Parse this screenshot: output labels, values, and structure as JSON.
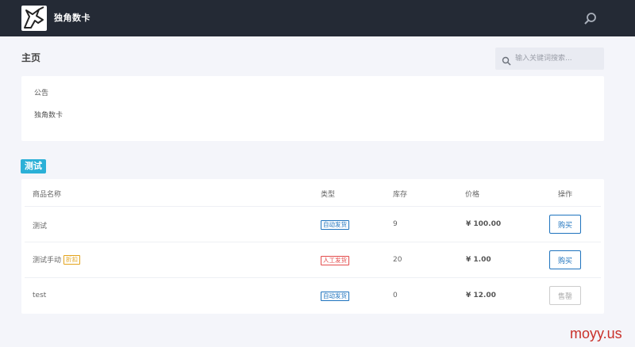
{
  "header": {
    "brand": "独角数卡",
    "logo_icon": "unicorn-logo",
    "search_icon": "search-icon"
  },
  "page": {
    "title": "主页",
    "search_placeholder": "输入关键词搜索..."
  },
  "notice": {
    "title": "公告",
    "body": "独角数卡"
  },
  "category": {
    "label": "测试"
  },
  "table": {
    "headers": {
      "name": "商品名称",
      "type": "类型",
      "stock": "库存",
      "price": "价格",
      "action": "操作"
    },
    "rows": [
      {
        "name": "测试",
        "discount": "",
        "type": "自动发货",
        "type_kind": "auto",
        "stock": "9",
        "price": "¥ 100.00",
        "action": "购买",
        "available": true
      },
      {
        "name": "测试手动",
        "discount": "折扣",
        "type": "人工发货",
        "type_kind": "manual",
        "stock": "20",
        "price": "¥ 1.00",
        "action": "购买",
        "available": true
      },
      {
        "name": "test",
        "discount": "",
        "type": "自动发货",
        "type_kind": "auto",
        "stock": "0",
        "price": "¥ 12.00",
        "action": "售罄",
        "available": false
      }
    ]
  },
  "colors": {
    "topbar": "#242a35",
    "category_tag": "#2bb0d7",
    "auto_badge": "#1e73be",
    "manual_badge": "#e34b4b",
    "discount_badge": "#e3a31a"
  },
  "watermark": "moyy.us"
}
